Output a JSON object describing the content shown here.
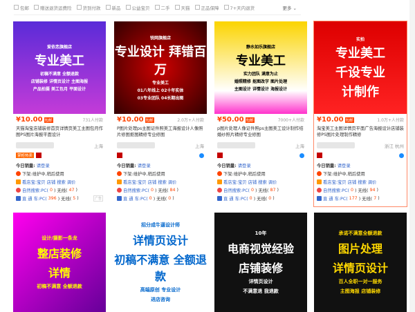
{
  "filters": [
    "包邮",
    "赠送退货运费险",
    "货到付款",
    "新品",
    "公益宝贝",
    "二手",
    "天猫",
    "正品保障",
    "7+天内退货"
  ],
  "more": "更多",
  "cards": [
    {
      "img": [
        "爱依恋旗舰店",
        "专业美工",
        "初稿不满意 全额退款",
        "店铺装修 详情页设计 主图海报",
        "产品拍摄 美工包月 平面设计"
      ],
      "price": "¥10.00",
      "by": "包邮",
      "paid": "731人付款",
      "title": "天猫淘宝店铺装修首页详情页美工主图包月作图PS图片海报平面设计",
      "loc": "上海",
      "badge": "掌柜热卖",
      "sales_label": "今日销量:",
      "sales_link": "请登录",
      "status": "下架:维护中,稍后使用",
      "tools": "看店宝:宝贝 店铺 搜索 调价",
      "natural": "自然搜索:PC(",
      "n_pc": "0",
      "n_mid": ") 无线(",
      "n_wl": "47",
      "zt": "直 通 车:PC(",
      "z_pc": "396",
      "z_wl": "5",
      "ad": "广告"
    },
    {
      "img": [
        "锐网旗舰店",
        "专业设计 拜错百万",
        "专业美工",
        "01八年线上 02十年实体",
        "03专业团队 04长期出图"
      ],
      "price": "¥10.00",
      "by": "包邮",
      "paid": "2.0万+人付款",
      "title": "P图片处理ps主图证件照美工海报设计人像照片修图抠图精修专业修图",
      "loc": "上海",
      "sales_label": "今日销量:",
      "sales_link": "请登录",
      "status": "下架:维护中,稍后使用",
      "tools": "看店宝:宝贝 店铺 搜索 调价",
      "natural": "自然搜索:PC(",
      "n_pc": "0",
      "n_mid": ") 无线(",
      "n_wl": "84",
      "zt": "直 通 车:PC(",
      "z_pc": "0",
      "z_wl": "0"
    },
    {
      "img": [
        "静水如乐旗舰店",
        "专业美工",
        "实力团队 满意为止",
        "婚照精修 抠图改字 图片处理",
        "主图设计 详情设计 海报设计"
      ],
      "price": "¥50.00",
      "by": "包邮",
      "paid": "7000+人付款",
      "title": "p图片处理人像证件照ps主图美工设计制作结婚纱照片精修专业修图",
      "loc": "上海",
      "sales_label": "今日销量:",
      "sales_link": "请登录",
      "status": "下架:维护中,稍后使用",
      "tools": "看店宝:宝贝 店铺 搜索 调价",
      "natural": "自然搜索:PC(",
      "n_pc": "0",
      "n_mid": ") 无线(",
      "n_wl": "87",
      "zt": "直 通 车:PC(",
      "z_pc": "0",
      "z_wl": "0"
    },
    {
      "img": [
        "实拍",
        "专业美工",
        "千设专业",
        "计制作"
      ],
      "price": "¥10.00",
      "by": "包邮",
      "paid": "1.0万+人付款",
      "title": "淘宝美工主图详情页平面广告海报设计店铺装修PS图片处理制作精修",
      "loc": "浙江 杭州",
      "sales_label": "今日销量:",
      "sales_link": "请登录",
      "status": "下架:维护中,稍后使用",
      "tools": "看店宝:宝贝 店铺 搜索 调价",
      "natural": "自然搜索:PC(",
      "n_pc": "0",
      "n_mid": ") 无线(",
      "n_wl": "94",
      "zt": "直 通 车:PC(",
      "z_pc": "177",
      "z_wl": "7"
    }
  ],
  "bottom": [
    [
      "设计/摄影一条龙",
      "整店装修",
      "详情",
      "初稿不满意 全额退款"
    ],
    [
      "招分成牛逼设计师",
      "详情页设计",
      "初稿不满意 全额退款",
      "高端原创 专业设计",
      "进店咨询"
    ],
    [
      "10年",
      "电商视觉经验",
      "店铺装修",
      "详情页设计",
      "不满意退 我退款"
    ],
    [
      "承诺不满意全额退款",
      "图片处理",
      "详情页设计",
      "百人全职一对一服务",
      "主图海报 店铺装修"
    ]
  ],
  "colors": {
    "price": "#ff4400",
    "link": "#3366cc"
  }
}
